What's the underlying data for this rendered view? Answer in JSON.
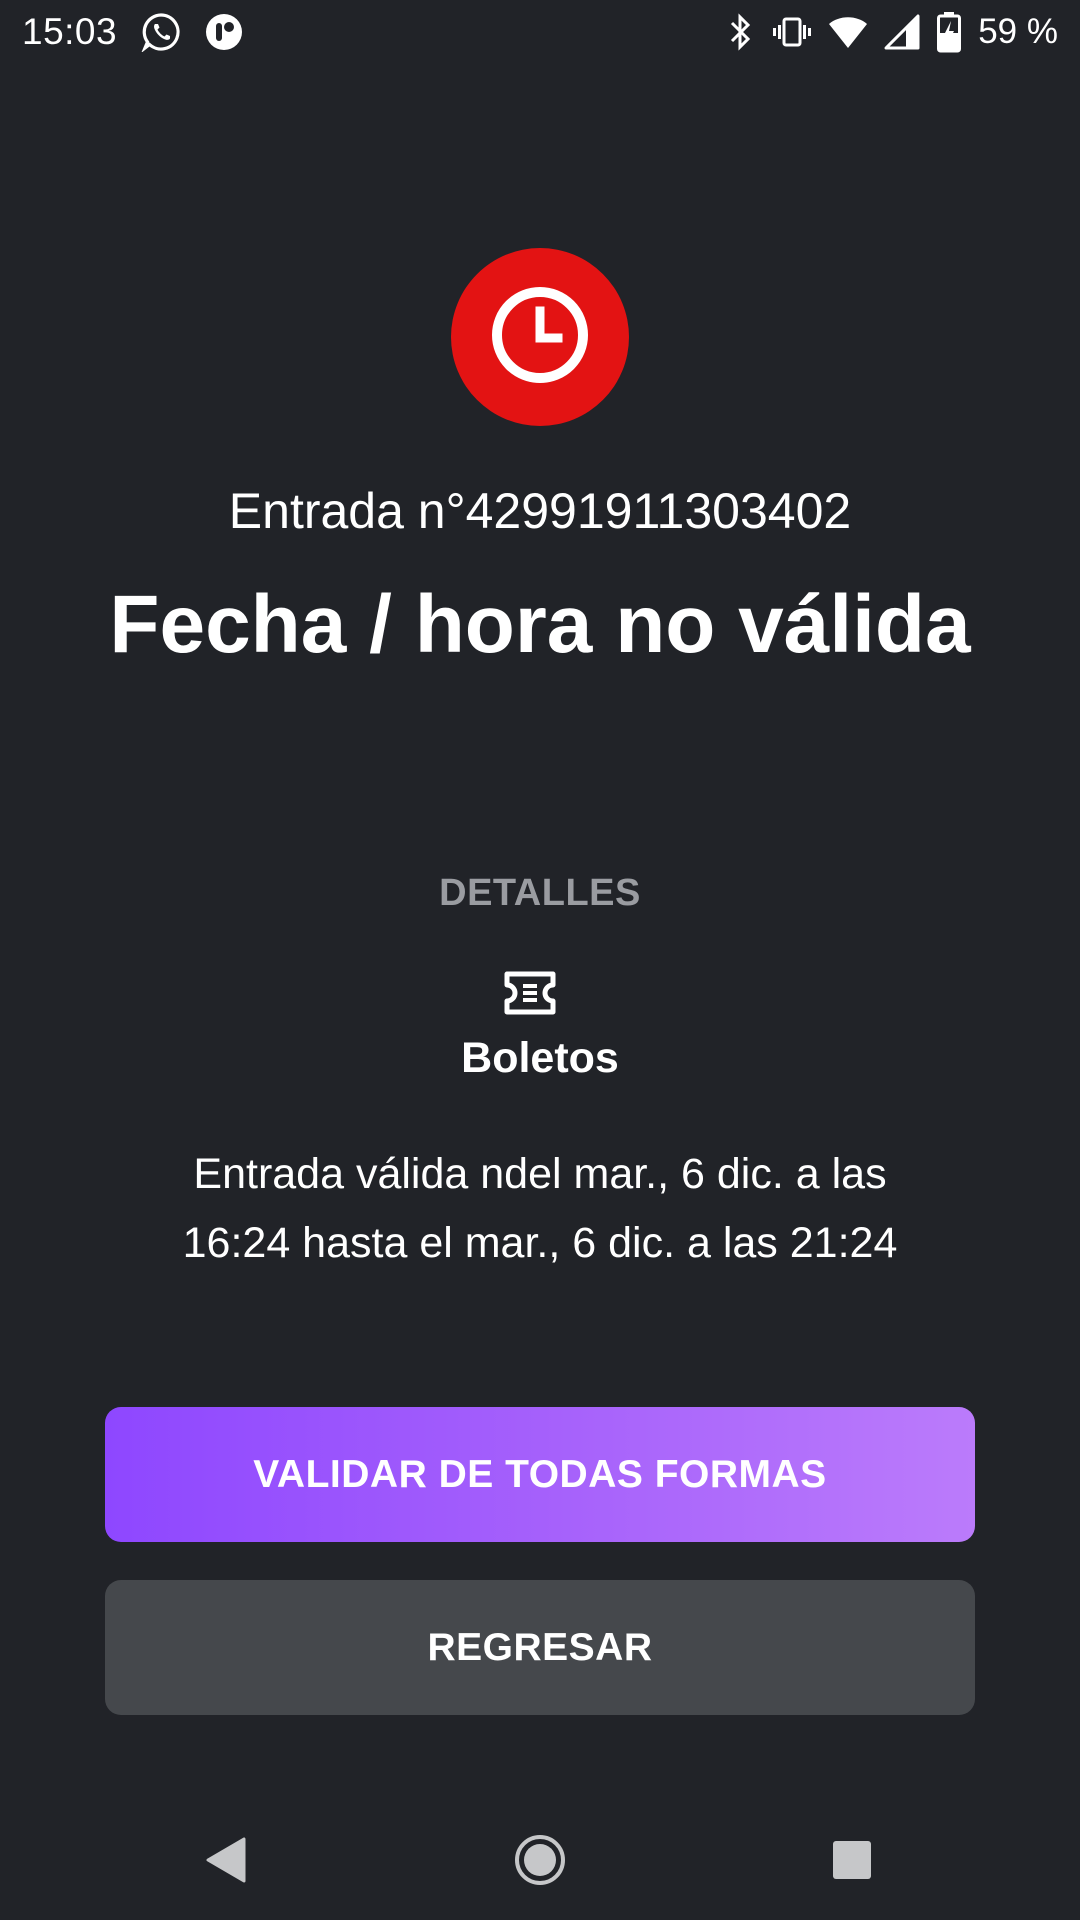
{
  "status_bar": {
    "time": "15:03",
    "battery": "59 %",
    "icons_left": [
      "whatsapp-icon",
      "app-notification-icon"
    ],
    "icons_right": [
      "bluetooth-icon",
      "vibrate-icon",
      "wifi-icon",
      "signal-icon",
      "battery-charging-icon"
    ]
  },
  "result": {
    "icon": "clock-icon",
    "accent_color": "#e31313",
    "ticket_number": "Entrada n°42991911303402",
    "title": "Fecha / hora no válida"
  },
  "details": {
    "heading": "DETALLES",
    "ticket_icon": "ticket-icon",
    "ticket_type": "Boletos",
    "validity_line1": "Entrada válida ndel mar., 6 dic. a las",
    "validity_line2": "16:24 hasta el mar., 6 dic. a las 21:24"
  },
  "actions": {
    "validate_label": "VALIDAR DE TODAS FORMAS",
    "validate_colors": [
      "#8e47ff",
      "#bb7bfb"
    ],
    "back_label": "REGRESAR",
    "back_color": "#45484c"
  },
  "nav_bar": {
    "icons": [
      "back-triangle-icon",
      "home-circle-icon",
      "recents-square-icon"
    ]
  }
}
